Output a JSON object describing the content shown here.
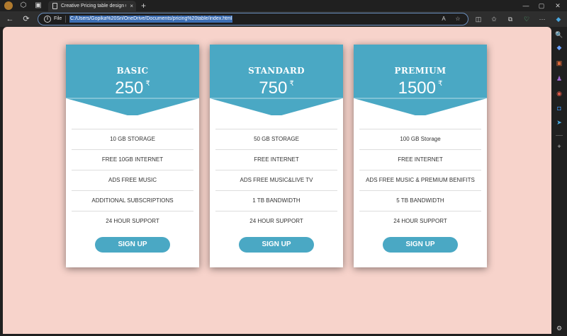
{
  "browser": {
    "tab_title": "Creative Pricing table design usi",
    "tab_close": "×",
    "new_tab": "+",
    "file_label": "File",
    "url": "C:/Users/Gopika%20Sri/OneDrive/Documents/pricing%20table/index.html",
    "icons": {
      "avatar": "profile-avatar-icon",
      "workspaces": "workspaces-icon",
      "tab_actions": "tab-actions-icon",
      "back": "←",
      "refresh": "⟳",
      "minimize": "—",
      "maximize": "▢",
      "close": "✕",
      "read_aloud": "A",
      "favorite": "☆",
      "split": "◫",
      "favorites": "✩",
      "collections": "⧉",
      "performance": "♡",
      "more": "···",
      "copilot": "◆"
    },
    "sidebar_icons": [
      "🔍",
      "◆",
      "▣",
      "♟",
      "◉",
      "◘",
      "➤",
      "+",
      "⚙"
    ]
  },
  "page": {
    "background": "#f7d3cb",
    "accent": "#4aa8c4",
    "plans": [
      {
        "name": "BASIC",
        "price": "250",
        "currency": "₹",
        "features": [
          "10 GB STORAGE",
          "FREE 10GB INTERNET",
          "ADS FREE MUSIC",
          "ADDITIONAL SUBSCRIPTIONS",
          "24 HOUR SUPPORT"
        ],
        "button": "SIGN UP"
      },
      {
        "name": "STANDARD",
        "price": "750",
        "currency": "₹",
        "features": [
          "50 GB STORAGE",
          "FREE INTERNET",
          "ADS FREE MUSIC&LIVE TV",
          "1 TB BANDWIDTH",
          "24 HOUR SUPPORT"
        ],
        "button": "SIGN UP"
      },
      {
        "name": "PREMIUM",
        "price": "1500",
        "currency": "₹",
        "features": [
          "100 GB Storage",
          "FREE INTERNET",
          "ADS FREE MUSIC & PREMIUM BENIFITS",
          "5 TB BANDWIDTH",
          "24 HOUR SUPPORT"
        ],
        "button": "SIGN UP"
      }
    ]
  }
}
